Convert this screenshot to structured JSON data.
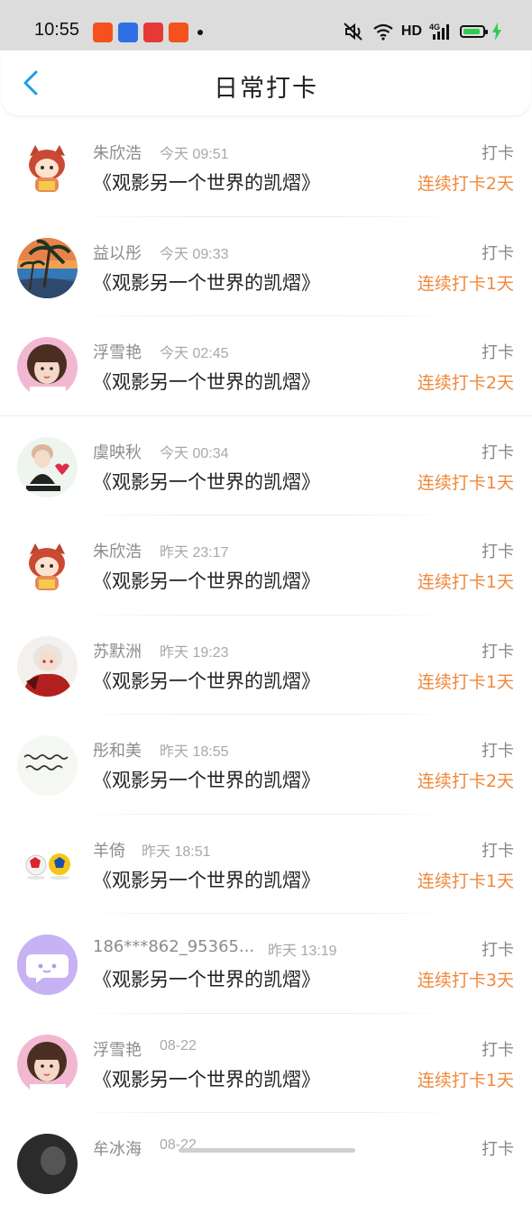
{
  "status_bar": {
    "time": "10:55",
    "hd": "HD",
    "network": "4G",
    "battery_level": 0.9,
    "app_icons": [
      {
        "icon": "app-icon-orange",
        "color": "#f4511e"
      },
      {
        "icon": "app-icon-baidu",
        "color": "#2f6fe4"
      },
      {
        "icon": "app-icon-toutiao",
        "color": "#e53935"
      },
      {
        "icon": "app-icon-orange",
        "color": "#f4511e"
      }
    ]
  },
  "header": {
    "title": "日常打卡"
  },
  "colors": {
    "accent": "#1e9be8",
    "streak": "#f0883a"
  },
  "entries": [
    {
      "name": "朱欣浩",
      "time": "今天 09:51",
      "content": "《观影另一个世界的凯熠》",
      "action": "打卡",
      "streak": "连续打卡2天",
      "avatar": "anime-character-avatar"
    },
    {
      "name": "益以彤",
      "time": "今天 09:33",
      "content": "《观影另一个世界的凯熠》",
      "action": "打卡",
      "streak": "连续打卡1天",
      "avatar": "beach-palm-sunset-avatar"
    },
    {
      "name": "浮雪艳",
      "time": "今天 02:45",
      "content": "《观影另一个世界的凯熠》",
      "action": "打卡",
      "streak": "连续打卡2天",
      "avatar": "girl-portrait-avatar"
    },
    {
      "name": "虞映秋",
      "time": "今天 00:34",
      "content": "《观影另一个世界的凯熠》",
      "action": "打卡",
      "streak": "连续打卡1天",
      "avatar": "boy-heart-avatar"
    },
    {
      "name": "朱欣浩",
      "time": "昨天 23:17",
      "content": "《观影另一个世界的凯熠》",
      "action": "打卡",
      "streak": "连续打卡1天",
      "avatar": "anime-character-avatar"
    },
    {
      "name": "苏默洲",
      "time": "昨天 19:23",
      "content": "《观影另一个世界的凯熠》",
      "action": "打卡",
      "streak": "连续打卡1天",
      "avatar": "anime-red-warrior-avatar"
    },
    {
      "name": "彤和美",
      "time": "昨天 18:55",
      "content": "《观影另一个世界的凯熠》",
      "action": "打卡",
      "streak": "连续打卡2天",
      "avatar": "handwriting-avatar"
    },
    {
      "name": "羊倚",
      "time": "昨天 18:51",
      "content": "《观影另一个世界的凯熠》",
      "action": "打卡",
      "streak": "连续打卡1天",
      "avatar": "soccer-balls-avatar"
    },
    {
      "name": "186***862_95365...",
      "time": "昨天 13:19",
      "content": "《观影另一个世界的凯熠》",
      "action": "打卡",
      "streak": "连续打卡3天",
      "avatar": "default-chat-avatar"
    },
    {
      "name": "浮雪艳",
      "time": "08-22",
      "content": "《观影另一个世界的凯熠》",
      "action": "打卡",
      "streak": "连续打卡1天",
      "avatar": "girl-portrait-avatar"
    },
    {
      "name": "牟冰海",
      "time": "08-22",
      "content": "",
      "action": "打卡",
      "streak": "",
      "avatar": "dark-photo-avatar"
    }
  ]
}
